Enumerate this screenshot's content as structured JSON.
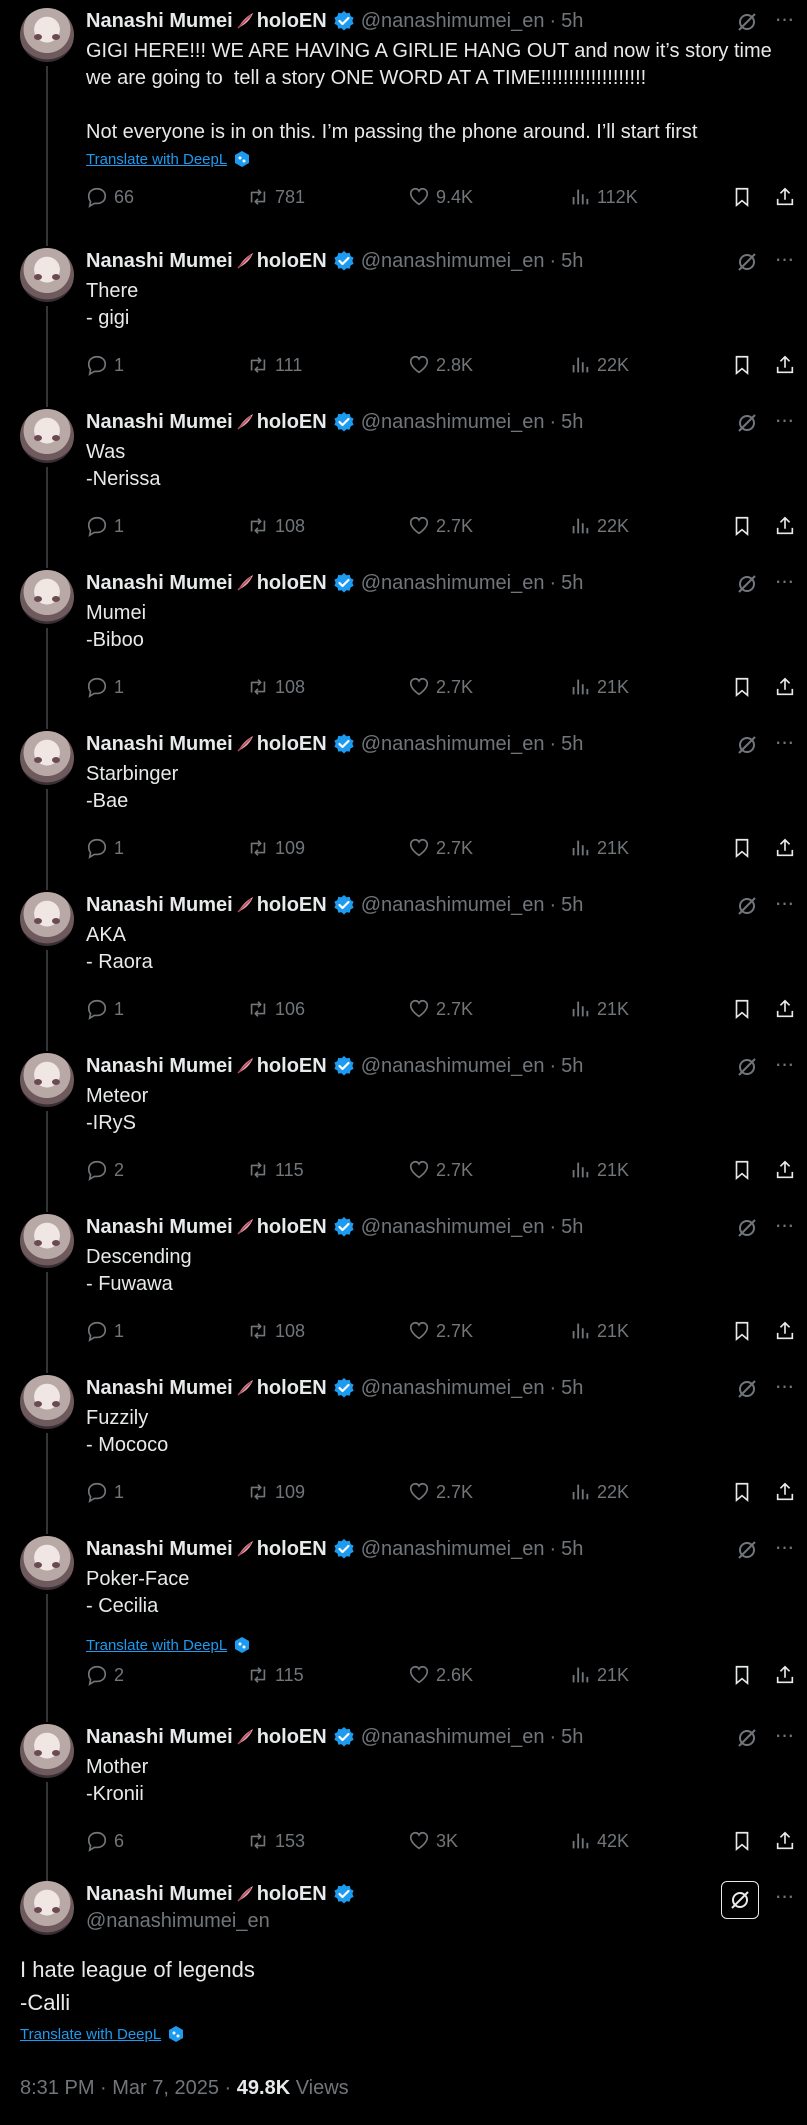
{
  "author": {
    "name": "Nanashi Mumei",
    "suffix": "holoEN",
    "handle": "@nanashimumei_en",
    "time": "5h",
    "dot": "·"
  },
  "translate_label": "Translate with DeepL",
  "tweets": [
    {
      "text": "GIGI HERE!!! WE ARE HAVING A GIRLIE HANG OUT and now it’s story time we are going to  tell a story ONE WORD AT A TIME!!!!!!!!!!!!!!!!!!!\n\nNot everyone is in on this. I’m passing the phone around. I’ll start first",
      "translate": true,
      "replies": "66",
      "retweets": "781",
      "likes": "9.4K",
      "views": "112K"
    },
    {
      "text": "There\n- gigi",
      "translate": false,
      "replies": "1",
      "retweets": "111",
      "likes": "2.8K",
      "views": "22K"
    },
    {
      "text": "Was\n-Nerissa",
      "translate": false,
      "replies": "1",
      "retweets": "108",
      "likes": "2.7K",
      "views": "22K"
    },
    {
      "text": "Mumei\n-Biboo",
      "translate": false,
      "replies": "1",
      "retweets": "108",
      "likes": "2.7K",
      "views": "21K"
    },
    {
      "text": "Starbinger\n-Bae",
      "translate": false,
      "replies": "1",
      "retweets": "109",
      "likes": "2.7K",
      "views": "21K"
    },
    {
      "text": "AKA\n- Raora",
      "translate": false,
      "replies": "1",
      "retweets": "106",
      "likes": "2.7K",
      "views": "21K"
    },
    {
      "text": "Meteor\n-IRyS",
      "translate": false,
      "replies": "2",
      "retweets": "115",
      "likes": "2.7K",
      "views": "21K"
    },
    {
      "text": "Descending\n- Fuwawa",
      "translate": false,
      "replies": "1",
      "retweets": "108",
      "likes": "2.7K",
      "views": "21K"
    },
    {
      "text": "Fuzzily\n- Mococo",
      "translate": false,
      "replies": "1",
      "retweets": "109",
      "likes": "2.7K",
      "views": "22K"
    },
    {
      "text": "Poker-Face\n- Cecilia",
      "translate": true,
      "replies": "2",
      "retweets": "115",
      "likes": "2.6K",
      "views": "21K"
    },
    {
      "text": "Mother\n-Kronii",
      "translate": false,
      "replies": "6",
      "retweets": "153",
      "likes": "3K",
      "views": "42K"
    }
  ],
  "main": {
    "text": "I hate league of legends\n-Calli",
    "timestamp": "8:31 PM · Mar 7, 2025 · ",
    "views_count": "49.8K",
    "views_label": " Views"
  },
  "colors": {
    "background": "#000000",
    "text": "#e7e9ea",
    "muted": "#71767b",
    "link": "#1d9bf0",
    "verified": "#1d9bf0"
  }
}
